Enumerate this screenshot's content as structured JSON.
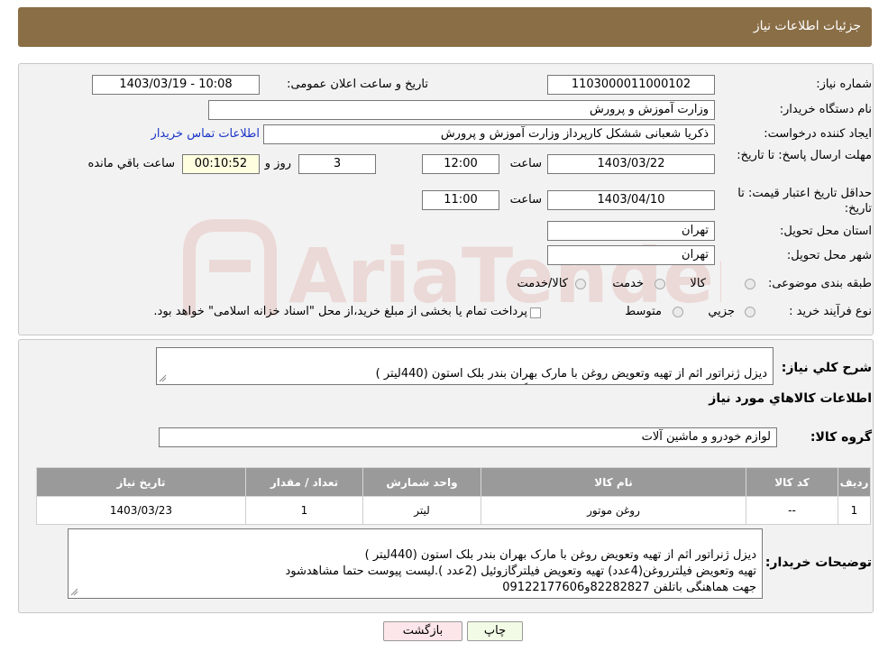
{
  "header": {
    "title": "جزئیات اطلاعات نیاز"
  },
  "info": {
    "need_number_label": "شماره نیاز:",
    "need_number": "1103000011000102",
    "announce_label": "تاریخ و ساعت اعلان عمومی:",
    "announce_value": "1403/03/19 - 10:08",
    "buyer_org_label": "نام دستگاه خریدار:",
    "buyer_org": "وزارت آموزش و پرورش",
    "creator_label": "ایجاد کننده درخواست:",
    "creator": "ذکریا شعبانی ششکل کارپرداز وزارت آموزش و پرورش",
    "contact_link": "اطلاعات تماس خریدار",
    "deadline_label": "مهلت ارسال پاسخ: تا تاریخ:",
    "deadline_date": "1403/03/22",
    "time_label": "ساعت",
    "deadline_time": "12:00",
    "days_value": "3",
    "days_label": "روز و",
    "remaining_time": "00:10:52",
    "remaining_label": "ساعت باقي مانده",
    "validity_label": "حداقل تاریخ اعتبار قیمت: تا تاریخ:",
    "validity_date": "1403/04/10",
    "validity_time_label": "ساعت",
    "validity_time": "11:00",
    "province_label": "استان محل تحویل:",
    "province": "تهران",
    "city_label": "شهر محل تحویل:",
    "city": "تهران",
    "category_label": "طبقه بندی موضوعی:",
    "category_options": [
      "کالا",
      "خدمت",
      "کالا/خدمت"
    ],
    "process_label": "نوع فرآیند خرید :",
    "process_options": [
      "جزیي",
      "متوسط"
    ],
    "process_note": "پرداخت تمام یا بخشی از مبلغ خرید،از محل \"اسناد خزانه اسلامی\" خواهد بود."
  },
  "description": {
    "label": "شرح کلي نياز:",
    "text": "دیزل ژنراتور اثم از تهیه وتعویض روغن با مارک بهران بندر بلک استون (440لیتر )\nتهیه وتعویض فیلترروغن(4عدد) تهیه وتعویض فیلترگازوئیل (2عدد )"
  },
  "goods": {
    "title": "اطلاعات کالاهاي مورد نياز",
    "group_label": "گروه کالا:",
    "group_value": "لوازم خودرو و ماشین آلات",
    "columns": [
      "رديف",
      "کد کالا",
      "نام کالا",
      "واحد شمارش",
      "تعداد / مقدار",
      "تاريخ نياز"
    ],
    "rows": [
      [
        "1",
        "--",
        "روغن موتور",
        "لیتر",
        "1",
        "1403/03/23"
      ]
    ]
  },
  "buyer_notes": {
    "label": "توضیحات خریدار:",
    "text": "دیزل ژنراتور اثم از تهیه وتعویض روغن با مارک بهران بندر بلک استون (440لیتر )\nتهیه وتعویض فیلترروغن(4عدد) تهیه وتعویض فیلترگازوئیل (2عدد ).لیست پیوست حتما مشاهدشود\nجهت هماهنگی باتلفن 82282827و09122177606"
  },
  "buttons": {
    "print": "چاپ",
    "back": "بازگشت"
  },
  "watermark": {
    "text": "AriaTender.neT"
  }
}
